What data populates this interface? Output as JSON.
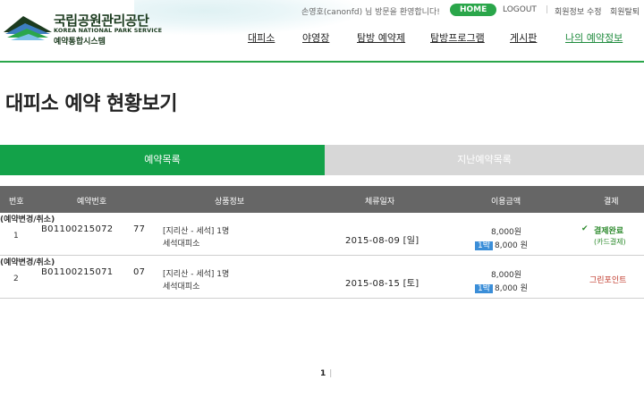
{
  "header": {
    "logo_ko": "국립공원관리공단",
    "logo_en": "KOREA NATIONAL PARK SERVICE",
    "logo_sub": "예약통합시스템",
    "welcome": "손영호(canonfd) 님 방문을 환영합니다!",
    "home": "HOME",
    "logout": "LOGOUT",
    "sep": "|",
    "edit_info": "회원정보 수정",
    "withdraw": "회원탈퇴"
  },
  "nav": {
    "items": [
      "대피소",
      "야영장",
      "탐방 예약제",
      "탐방프로그램",
      "게시판",
      "나의 예약정보"
    ]
  },
  "page": {
    "title": "대피소 예약 현황보기"
  },
  "tabs": {
    "active": "예약목록",
    "inactive": "지난예약목록"
  },
  "table": {
    "headers": {
      "no": "번호",
      "res_no": "예약번호",
      "product": "상품정보",
      "stay_date": "체류일자",
      "amount": "이용금액",
      "payment": "결제"
    },
    "rows": [
      {
        "no": "1",
        "res_no": "B01100215072",
        "code": "77",
        "change": "(예약변경/취소)",
        "product_line1": "[지리산 - 세석] 1명",
        "product_line2": "세석대피소",
        "date": "2015-08-09 [일]",
        "price": "8,000원",
        "nights": "1박",
        "nights_amount": "8,000 원",
        "payment_check": "✔",
        "payment": "결제완료",
        "payment_sub": "(카드결제)"
      },
      {
        "no": "2",
        "res_no": "B01100215071",
        "code": "07",
        "change": "(예약변경/취소)",
        "product_line1": "[지리산 - 세석] 1명",
        "product_line2": "세석대피소",
        "date": "2015-08-15 [토]",
        "price": "8,000원",
        "nights": "1박",
        "nights_amount": "8,000 원",
        "payment": "그린포인트"
      }
    ]
  },
  "pager": {
    "current": "1",
    "bar": "|"
  },
  "colors": {
    "brand_green": "#13a249",
    "header_line": "#2aa64a",
    "table_head": "#666666",
    "tab_inactive": "#d7d7d7",
    "nights_badge": "#3b8ed8"
  }
}
